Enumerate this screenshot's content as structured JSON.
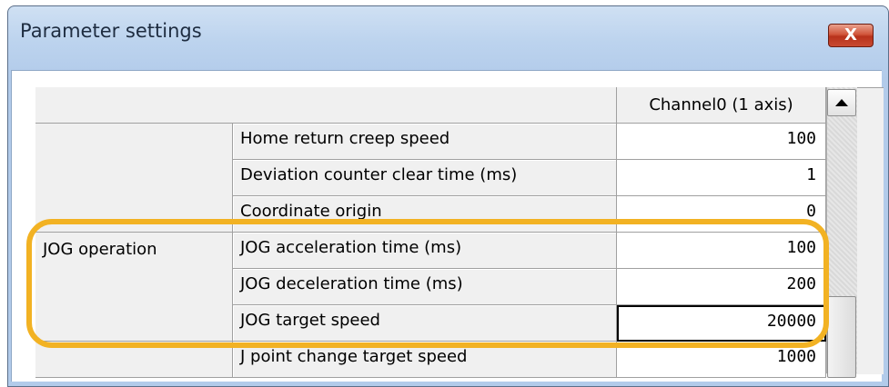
{
  "window": {
    "title": "Parameter settings",
    "close_label": "X"
  },
  "table": {
    "column_header": "Channel0 (1 axis)",
    "groups": [
      {
        "name": "JOG operation"
      }
    ],
    "rows": [
      {
        "label": "Home return creep speed",
        "value": "100"
      },
      {
        "label": "Deviation counter clear time (ms)",
        "value": "1"
      },
      {
        "label": "Coordinate origin",
        "value": "0"
      },
      {
        "label": "JOG acceleration time (ms)",
        "value": "100"
      },
      {
        "label": "JOG deceleration time (ms)",
        "value": "200"
      },
      {
        "label": "JOG target speed",
        "value": "20000"
      },
      {
        "label": "J point change target speed",
        "value": "1000"
      }
    ]
  },
  "highlight": {
    "color": "#f2b223"
  }
}
